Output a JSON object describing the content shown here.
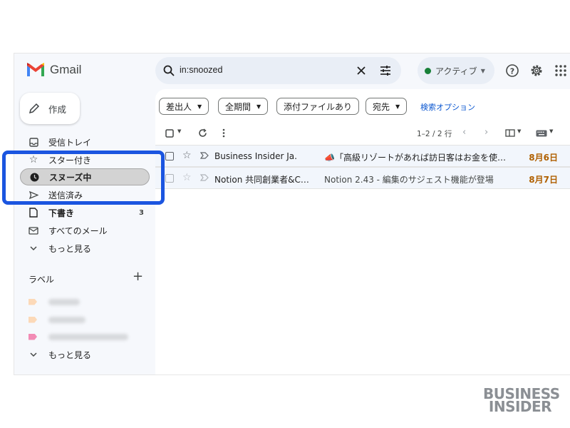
{
  "header": {
    "app_name": "Gmail",
    "search_query": "in:snoozed",
    "status_label": "アクティブ"
  },
  "compose": {
    "label": "作成"
  },
  "nav": {
    "items": [
      {
        "label": "受信トレイ",
        "icon": "inbox-icon"
      },
      {
        "label": "スター付き",
        "icon": "star-icon"
      },
      {
        "label": "スヌーズ中",
        "icon": "clock-icon",
        "active": true
      },
      {
        "label": "送信済み",
        "icon": "send-icon"
      },
      {
        "label": "下書き",
        "icon": "draft-icon",
        "count": "3"
      },
      {
        "label": "すべてのメール",
        "icon": "all-mail-icon"
      },
      {
        "label": "もっと見る",
        "icon": "chevron-down-icon"
      }
    ],
    "labels_heading": "ラベル",
    "labels_more": "もっと見る"
  },
  "filters": {
    "chips": [
      "差出人",
      "全期間",
      "添付ファイルあり",
      "宛先"
    ],
    "advanced": "検索オプション"
  },
  "toolbar": {
    "pager": "1–2 / 2 行"
  },
  "emails": [
    {
      "sender": "Business Insider Ja.",
      "subject": "📣「高級リゾートがあれば訪日客はお金を使…",
      "date": "8月6日"
    },
    {
      "sender": "Notion 共同創業者&C…",
      "subject": "Notion 2.43 - 編集のサジェスト機能が登場",
      "date": "8月7日"
    }
  ],
  "watermark": {
    "line1": "BUSINESS",
    "line2": "INSIDER"
  },
  "colors": {
    "highlight": "#1b55e0",
    "status_dot": "#188038",
    "date": "#b06000",
    "label_tags": [
      "#fcd9b8",
      "#fcd9b8",
      "#f28bb5"
    ]
  }
}
